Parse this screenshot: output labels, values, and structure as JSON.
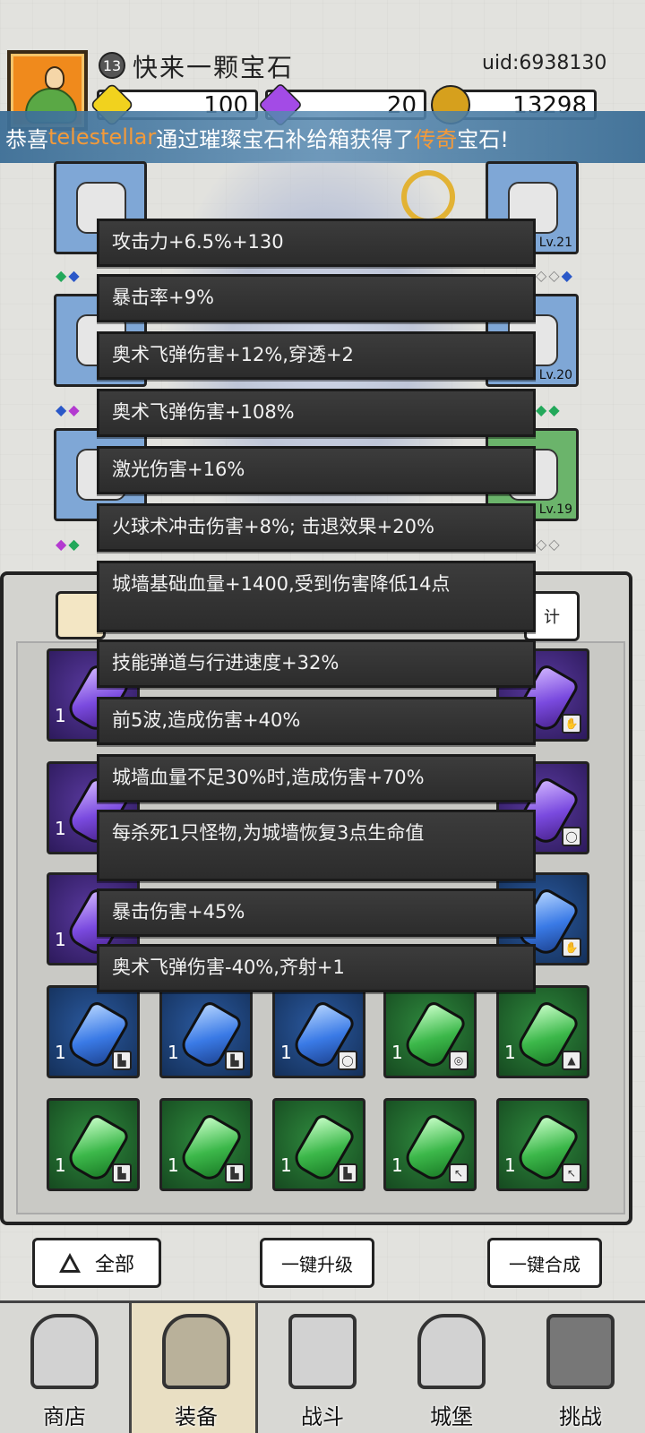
{
  "header": {
    "level": "13",
    "player_name": "快来一颗宝石",
    "uid": "uid:6938130",
    "resources": [
      "100",
      "20",
      "13298"
    ]
  },
  "announcement": {
    "prefix": "恭喜 ",
    "user": "telestellar",
    "middle": " 通过璀璨宝石补给箱获得了 ",
    "rarity": "传奇",
    "suffix": " 宝石!"
  },
  "equipment": {
    "right_levels": [
      "Lv.21",
      "Lv.20",
      "Lv.19"
    ]
  },
  "tab_right_label": "计",
  "tooltip_lines": [
    "攻击力+6.5%+130",
    "暴击率+9%",
    "奥术飞弹伤害+12%,穿透+2",
    "奥术飞弹伤害+108%",
    "激光伤害+16%",
    "火球术冲击伤害+8%; 击退效果+20%",
    "城墙基础血量+1400,受到伤害降低14点",
    "技能弹道与行进速度+32%",
    "前5波,造成伤害+40%",
    "城墙血量不足30%时,造成伤害+70%",
    "每杀死1只怪物,为城墙恢复3点生命值",
    "暴击伤害+45%",
    "奥术飞弹伤害-40%,齐射+1"
  ],
  "gems": {
    "count_label": "1"
  },
  "actions": {
    "all": "全部",
    "upgrade": "一键升级",
    "merge": "一键合成"
  },
  "nav": [
    "商店",
    "装备",
    "战斗",
    "城堡",
    "挑战"
  ]
}
